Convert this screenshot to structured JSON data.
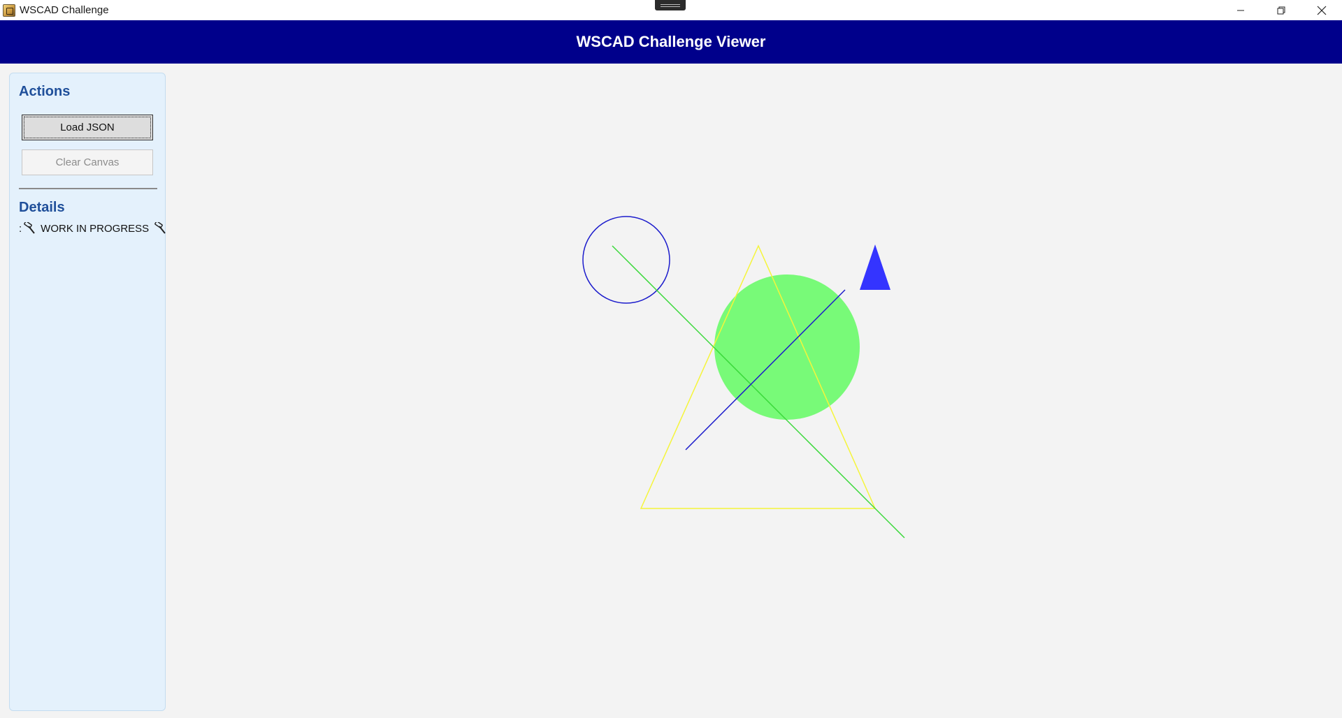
{
  "window": {
    "title": "WSCAD Challenge",
    "app_icon": "app-icon",
    "controls": [
      "minimize-icon",
      "restore-icon",
      "close-icon"
    ]
  },
  "header": {
    "title": "WSCAD Challenge Viewer",
    "background": "#00008b"
  },
  "sidebar": {
    "actions_title": "Actions",
    "load_button": "Load JSON",
    "clear_button": "Clear Canvas",
    "clear_button_enabled": false,
    "details_title": "Details",
    "details_prefix": ":",
    "details_status": "WORK IN PROGRESS",
    "details_icon": "hammer-icon"
  },
  "canvas_shapes": [
    {
      "type": "circle",
      "stroke": "#1c1ccc",
      "filled": false
    },
    {
      "type": "circle",
      "color": "#78fa78",
      "filled": true
    },
    {
      "type": "triangle",
      "stroke": "#f5f53a",
      "filled": false
    },
    {
      "type": "triangle",
      "color": "#3434ff",
      "filled": true
    },
    {
      "type": "line",
      "color": "#3ad83a"
    },
    {
      "type": "line",
      "color": "#1c1ccc"
    }
  ]
}
